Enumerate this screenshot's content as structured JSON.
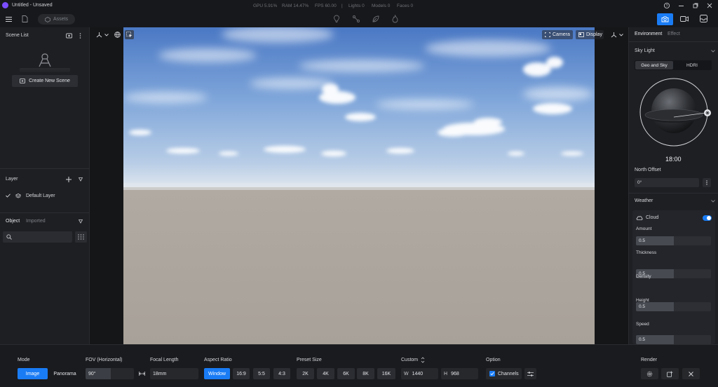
{
  "titlebar": {
    "title": "Untitled - Unsaved",
    "stats": {
      "gpu": "GPU 5.91%",
      "ram": "RAM 14.47%",
      "fps": "FPS 60.00",
      "lights": "Lights 0",
      "models": "Models 0",
      "faces": "Faces 0"
    }
  },
  "topbar": {
    "assets_label": "Assets",
    "modes": [
      {
        "icon": "camera-icon",
        "active": true
      },
      {
        "icon": "video-icon",
        "active": false
      },
      {
        "icon": "inbox-icon",
        "active": false
      }
    ]
  },
  "left": {
    "scene_list_title": "Scene List",
    "create_scene_label": "Create New Scene",
    "layer_title": "Layer",
    "default_layer": "Default Layer",
    "tabs": [
      "Object",
      "Imported"
    ]
  },
  "viewport": {
    "camera_label": "Camera",
    "display_label": "Display"
  },
  "right": {
    "tabs": [
      "Environment",
      "Effect"
    ],
    "sky_light_title": "Sky Light",
    "sky_modes": [
      "Geo and Sky",
      "HDRI"
    ],
    "time": "18:00",
    "north_offset_label": "North Offset",
    "north_offset_value": "0°",
    "weather_title": "Weather",
    "cloud_label": "Cloud",
    "cloud_enabled": true,
    "sliders": [
      {
        "label": "Amount",
        "value": "0.5",
        "fraction": 0.5
      },
      {
        "label": "Thickness",
        "value": "0.5",
        "fraction": 0.5
      },
      {
        "label": "Density",
        "value": "0.5",
        "fraction": 0.5
      },
      {
        "label": "Height",
        "value": "0.5",
        "fraction": 0.5
      },
      {
        "label": "Speed",
        "value": "0.1",
        "fraction": 0.0
      }
    ]
  },
  "bottom": {
    "mode_label": "Mode",
    "modes": [
      "Image",
      "Panorama"
    ],
    "active_mode": "Image",
    "fov_label": "FOV (Horizontal)",
    "fov_value": "90°",
    "focal_label": "Focal Length",
    "focal_value": "18mm",
    "aspect_label": "Aspect Ratio",
    "aspects": [
      "Window",
      "16:9",
      "5:5",
      "4:3"
    ],
    "active_aspect": "Window",
    "preset_label": "Preset Size",
    "presets": [
      "2K",
      "4K",
      "6K",
      "8K",
      "16K"
    ],
    "custom_label": "Custom",
    "width_prefix": "W",
    "width_value": "1440",
    "height_prefix": "H",
    "height_value": "968",
    "option_label": "Option",
    "channels_label": "Channels",
    "channels_checked": true,
    "render_label": "Render"
  },
  "colors": {
    "accent": "#1a7cf5",
    "app_logo": "#7b4dff",
    "sky_top": "#4a78c4",
    "ground": "#aca59d"
  }
}
